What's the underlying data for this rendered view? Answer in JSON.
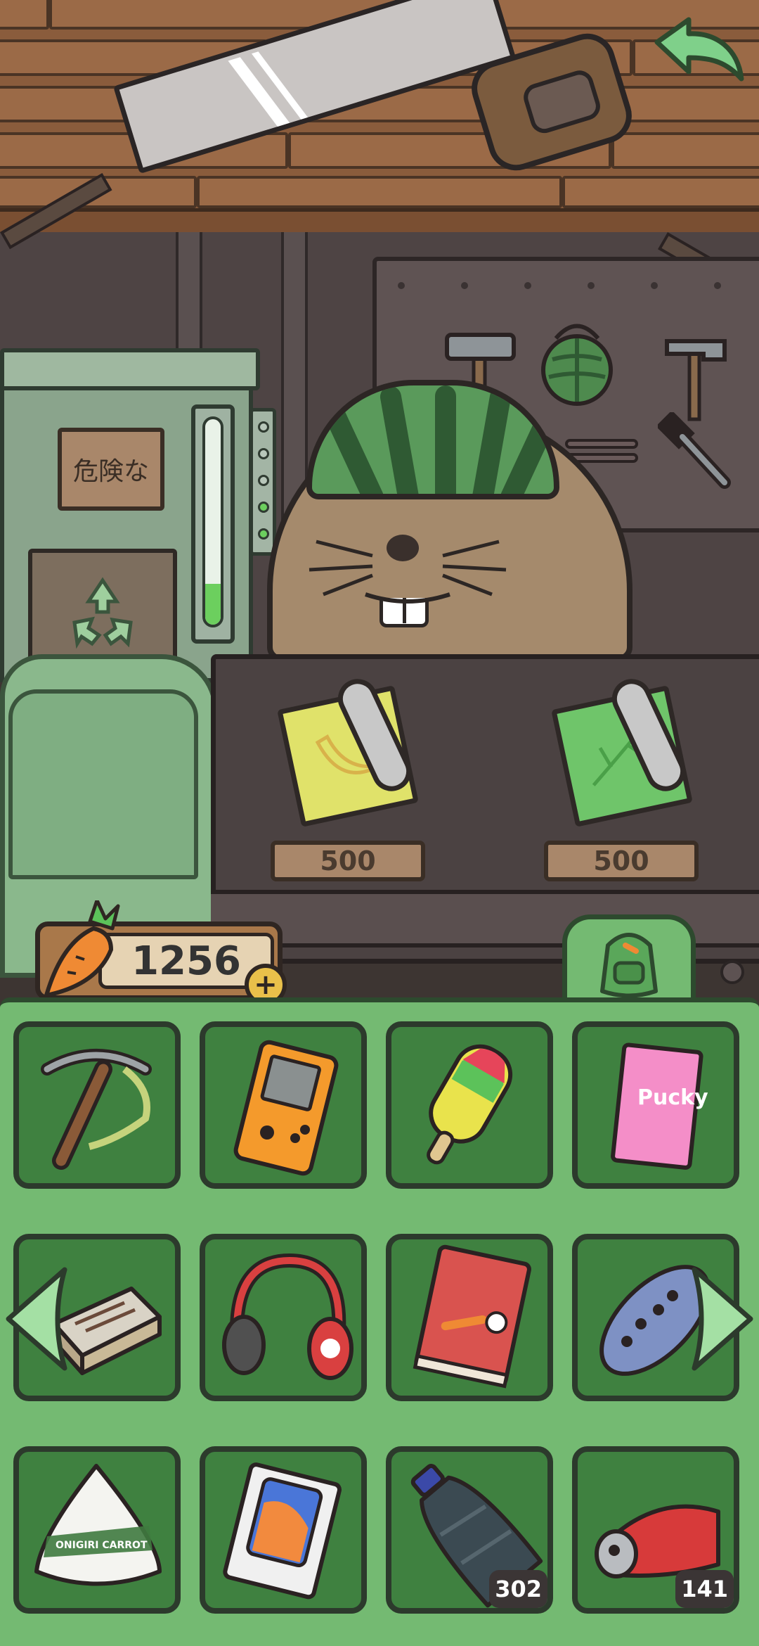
{
  "shop": {
    "prices": [
      "500",
      "500"
    ],
    "items": [
      "banana-blueprint",
      "leaf-blueprint"
    ]
  },
  "wallet": {
    "carrots": "1256",
    "add_label": "+"
  },
  "danger_sign": "危険な",
  "gauge_level": 0.2,
  "inventory": {
    "items": [
      {
        "icon": "pickaxe-icon"
      },
      {
        "icon": "handheld-console-icon"
      },
      {
        "icon": "popsicle-icon"
      },
      {
        "icon": "pocky-box-icon",
        "label": "Pucky"
      },
      {
        "icon": "matchbox-icon"
      },
      {
        "icon": "headphones-icon"
      },
      {
        "icon": "book-icon"
      },
      {
        "icon": "remote-control-icon"
      },
      {
        "icon": "onigiri-icon",
        "label": "ONIGIRI CARROT"
      },
      {
        "icon": "phone-box-icon"
      },
      {
        "icon": "plastic-bottle-icon",
        "count": "302"
      },
      {
        "icon": "crushed-can-icon",
        "count": "141"
      }
    ]
  },
  "colors": {
    "inventory_bg": "#74ba72",
    "slot_bg": "#3f8140",
    "wall": "#8a5c3c"
  }
}
